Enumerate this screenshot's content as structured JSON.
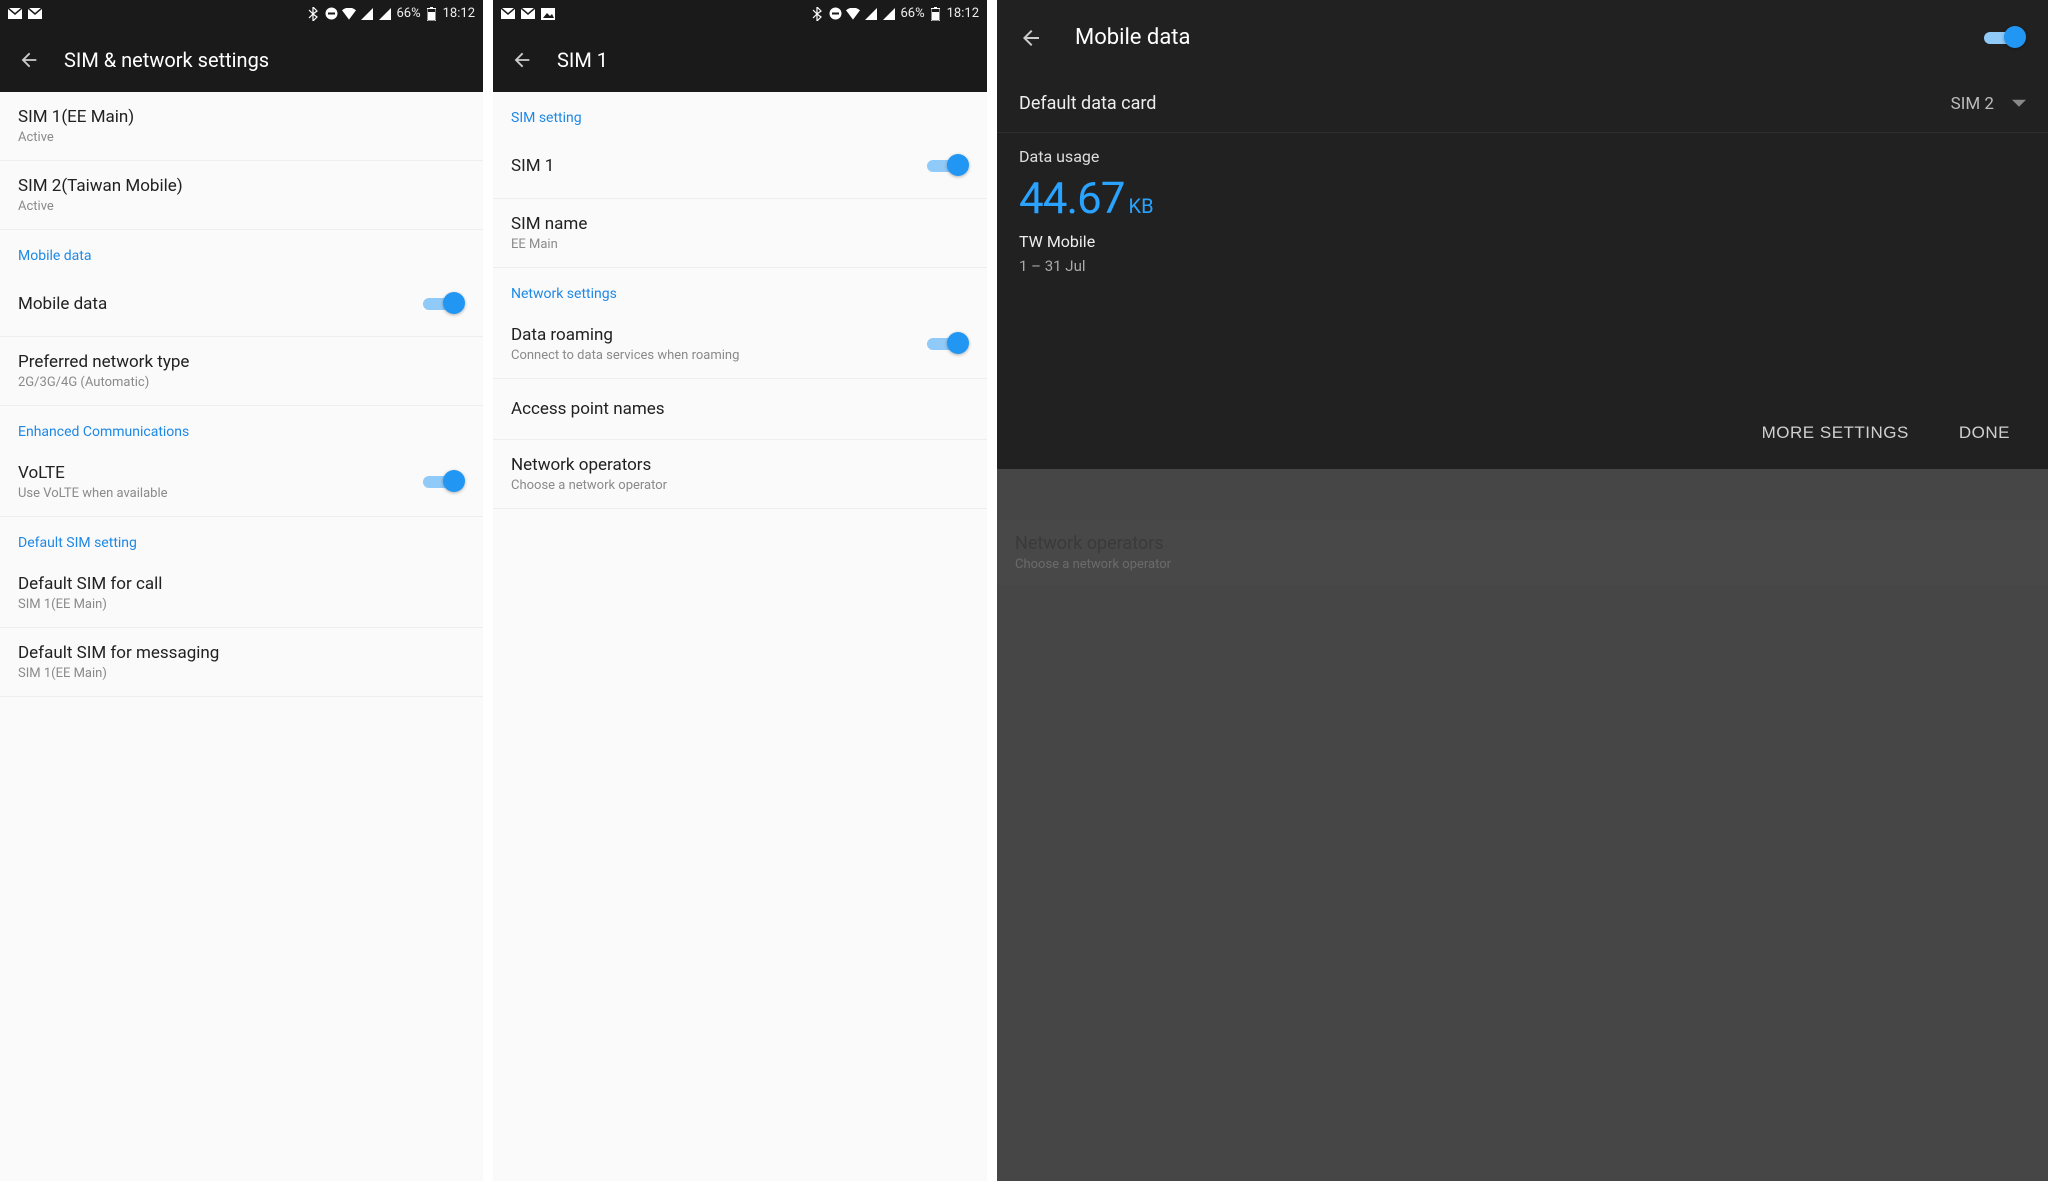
{
  "status": {
    "battery": "66%",
    "time": "18:12"
  },
  "screen1": {
    "title": "SIM & network settings",
    "sim1": {
      "label": "SIM 1(EE Main)",
      "status": "Active"
    },
    "sim2": {
      "label": "SIM 2(Taiwan Mobile)",
      "status": "Active"
    },
    "sections": {
      "mobile_data": "Mobile data",
      "enhanced": "Enhanced Communications",
      "default_sim": "Default SIM setting"
    },
    "mobile_data_label": "Mobile data",
    "preferred": {
      "label": "Preferred network type",
      "value": "2G/3G/4G (Automatic)"
    },
    "volte": {
      "label": "VoLTE",
      "sub": "Use VoLTE when available"
    },
    "def_call": {
      "label": "Default SIM for call",
      "value": "SIM 1(EE Main)"
    },
    "def_msg": {
      "label": "Default SIM for messaging",
      "value": "SIM 1(EE Main)"
    }
  },
  "screen2": {
    "title": "SIM 1",
    "sections": {
      "sim": "SIM setting",
      "network": "Network settings"
    },
    "sim_enable_label": "SIM 1",
    "sim_name": {
      "label": "SIM name",
      "value": "EE Main"
    },
    "roaming": {
      "label": "Data roaming",
      "sub": "Connect to data services when roaming"
    },
    "apn_label": "Access point names",
    "operators": {
      "label": "Network operators",
      "sub": "Choose a network operator"
    }
  },
  "screen3": {
    "title": "Mobile data",
    "default_card": {
      "label": "Default data card",
      "value": "SIM 2"
    },
    "usage": {
      "label": "Data usage",
      "amount": "44.67",
      "unit": "KB",
      "carrier": "TW Mobile",
      "range": "1 – 31 Jul"
    },
    "more_btn": "MORE SETTINGS",
    "done_btn": "DONE",
    "bg_operators": {
      "label": "Network operators",
      "sub": "Choose a network operator"
    }
  }
}
